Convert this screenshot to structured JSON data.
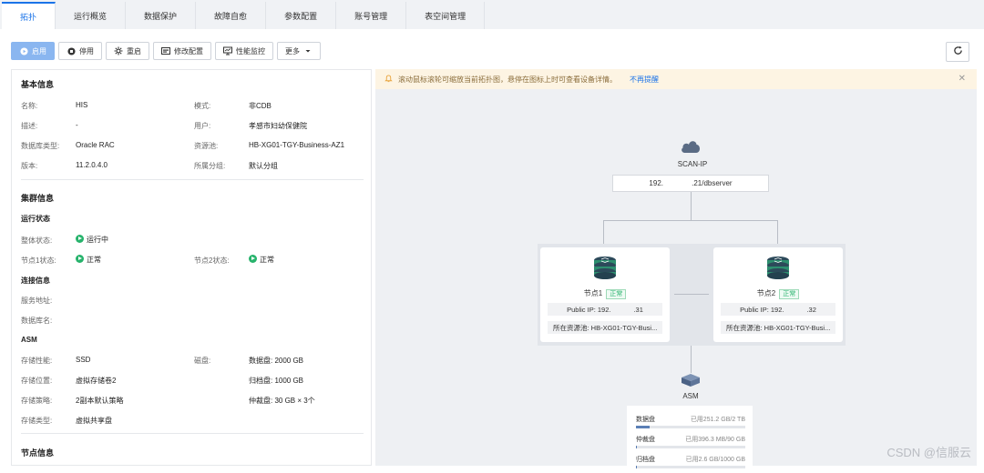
{
  "tabs": [
    "拓扑",
    "运行概览",
    "数据保护",
    "故障自愈",
    "参数配置",
    "账号管理",
    "表空间管理"
  ],
  "toolbar": {
    "start": "启用",
    "stop": "停用",
    "restart": "重启",
    "modify": "修改配置",
    "monitor": "性能监控",
    "more": "更多"
  },
  "basic": {
    "title": "基本信息",
    "name_label": "名称:",
    "name": "HIS",
    "mode_label": "模式:",
    "mode": "非CDB",
    "desc_label": "描述:",
    "desc": "-",
    "user_label": "用户:",
    "user": "孝感市妇幼保健院",
    "dbtype_label": "数据库类型:",
    "dbtype": "Oracle RAC",
    "pool_label": "资源池:",
    "pool": "HB-XG01-TGY-Business-AZ1",
    "version_label": "版本:",
    "version": "11.2.0.4.0",
    "group_label": "所属分组:",
    "group": "默认分组"
  },
  "cluster": {
    "title": "集群信息",
    "run_title": "运行状态",
    "overall_label": "整体状态:",
    "overall": "运行中",
    "node1_label": "节点1状态:",
    "node1": "正常",
    "node2_label": "节点2状态:",
    "node2": "正常",
    "conn_title": "连接信息",
    "addr_label": "服务地址:",
    "dbname_label": "数据库名:"
  },
  "asm": {
    "title": "ASM",
    "perf_label": "存储性能:",
    "perf": "SSD",
    "disk_label": "磁盘:",
    "data_disk": "数据盘: 2000 GB",
    "loc_label": "存储位置:",
    "loc": "虚拟存储卷2",
    "archive_disk": "归档盘: 1000 GB",
    "policy_label": "存储策略:",
    "policy": "2副本默认策略",
    "arbit_disk": "仲裁盘: 30 GB × 3个",
    "type_label": "存储类型:",
    "type": "虚拟共享盘"
  },
  "node_info_title": "节点信息",
  "topology": {
    "banner": "滚动鼠标滚轮可缩放当前拓扑图，悬停在图标上时可查看设备详情。",
    "banner_link": "不再提醒",
    "scan_label": "SCAN-IP",
    "scan_ip": "192.              .21/dbserver",
    "nodes": [
      {
        "name": "节点1",
        "status": "正常",
        "ip": "Public IP: 192.            .31",
        "pool": "所在资源池: HB-XG01-TGY-Busi..."
      },
      {
        "name": "节点2",
        "status": "正常",
        "ip": "Public IP: 192.            .32",
        "pool": "所在资源池: HB-XG01-TGY-Busi..."
      }
    ],
    "asm_label": "ASM",
    "asm_rows": [
      {
        "name": "数据盘",
        "used": "已用251.2 GB/2 TB",
        "fraction": 0.123
      },
      {
        "name": "仲裁盘",
        "used": "已用396.3 MB/90 GB",
        "fraction": 0.004
      },
      {
        "name": "归档盘",
        "used": "已用2.6 GB/1000 GB",
        "fraction": 0.003
      }
    ]
  },
  "watermark": "CSDN @信服云"
}
